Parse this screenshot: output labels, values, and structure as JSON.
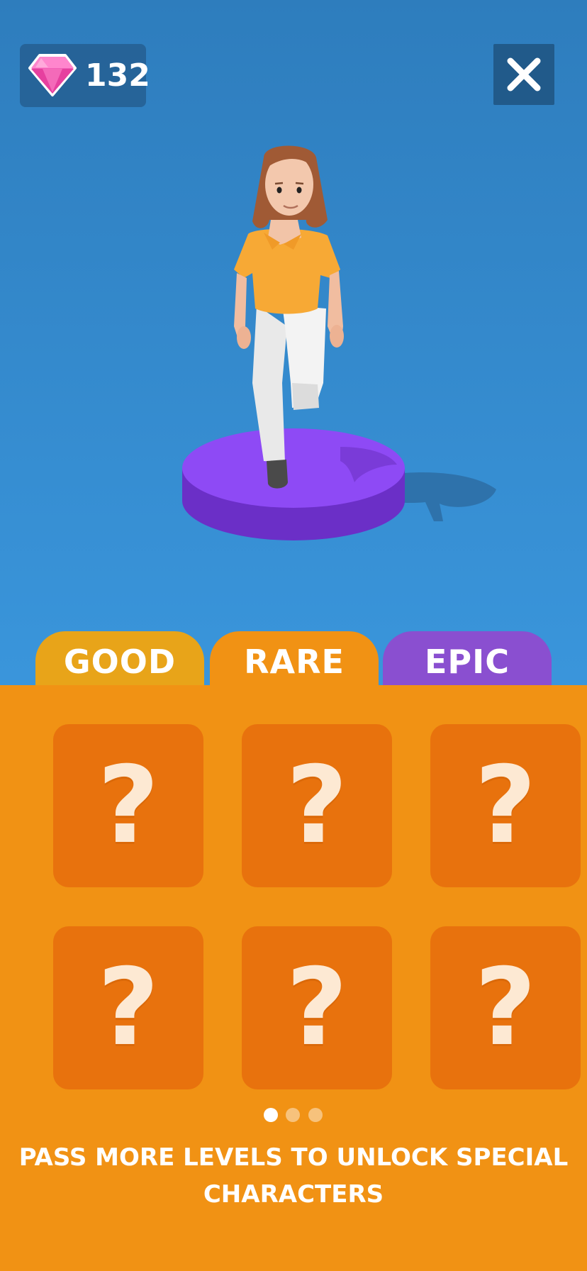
{
  "header": {
    "gem_count": "132",
    "gem_icon": "pink-gem-icon",
    "close_icon": "close-x-icon"
  },
  "scene": {
    "character": "female character in orange shirt and white pants standing on a purple pedestal"
  },
  "tabs": [
    {
      "label": "GOOD",
      "color": "#e8a419"
    },
    {
      "label": "RARE",
      "color": "#f19214",
      "selected": true
    },
    {
      "label": "EPIC",
      "color": "#8a4fd0"
    }
  ],
  "grid": {
    "slots": [
      "?",
      "?",
      "?",
      "?",
      "?",
      "?"
    ]
  },
  "pagination": {
    "total": 3,
    "active": 1
  },
  "hint": {
    "text": "PASS MORE LEVELS TO UNLOCK SPECIAL CHARACTERS"
  },
  "colors": {
    "sky_top": "#2e7dbd",
    "sky_bottom": "#3a9ae0",
    "panel": "#f19214",
    "slot": "#e8720d",
    "pedestal": "#8a44f0"
  }
}
